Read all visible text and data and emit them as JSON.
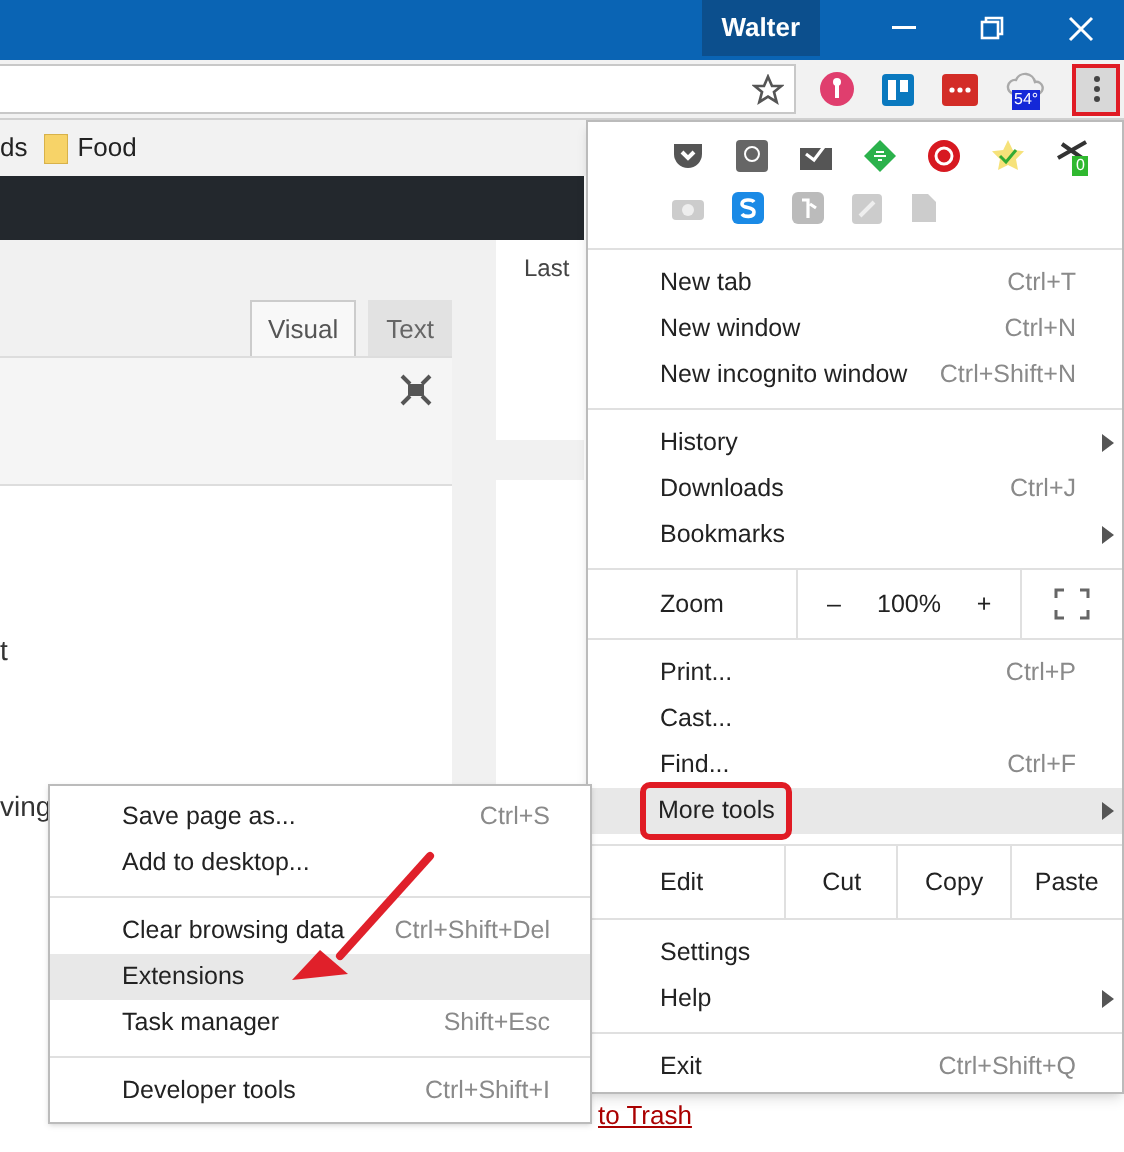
{
  "window": {
    "user": "Walter"
  },
  "toolbar": {
    "weather_badge": "54°",
    "menu_button_annotated": true
  },
  "bookmarks": [
    {
      "label": "ds"
    },
    {
      "label": "Food"
    }
  ],
  "editor": {
    "tabs": [
      {
        "label": "Visual",
        "selected": true
      },
      {
        "label": "Text",
        "selected": false
      }
    ],
    "fragments": [
      "t",
      "ving"
    ],
    "side_label": "Last",
    "link": "to Trash"
  },
  "menu": {
    "extension_badge": "0",
    "sections": [
      [
        {
          "kind": "item",
          "label": "New tab",
          "shortcut": "Ctrl+T",
          "submenu": false,
          "highlighted": false,
          "annotated": false
        },
        {
          "kind": "item",
          "label": "New window",
          "shortcut": "Ctrl+N",
          "submenu": false,
          "highlighted": false,
          "annotated": false
        },
        {
          "kind": "item",
          "label": "New incognito window",
          "shortcut": "Ctrl+Shift+N",
          "submenu": false,
          "highlighted": false,
          "annotated": false
        }
      ],
      [
        {
          "kind": "item",
          "label": "History",
          "submenu": true,
          "highlighted": false,
          "annotated": false
        },
        {
          "kind": "item",
          "label": "Downloads",
          "shortcut": "Ctrl+J",
          "submenu": false,
          "highlighted": false,
          "annotated": false
        },
        {
          "kind": "item",
          "label": "Bookmarks",
          "submenu": true,
          "highlighted": false,
          "annotated": false
        }
      ],
      [
        {
          "kind": "zoom",
          "label": "Zoom",
          "minus": "–",
          "value": "100%",
          "plus": "+"
        }
      ],
      [
        {
          "kind": "item",
          "label": "Print...",
          "shortcut": "Ctrl+P",
          "submenu": false,
          "highlighted": false,
          "annotated": false
        },
        {
          "kind": "item",
          "label": "Cast...",
          "submenu": false,
          "highlighted": false,
          "annotated": false
        },
        {
          "kind": "item",
          "label": "Find...",
          "shortcut": "Ctrl+F",
          "submenu": false,
          "highlighted": false,
          "annotated": false
        },
        {
          "kind": "item",
          "label": "More tools",
          "submenu": true,
          "highlighted": true,
          "annotated": true
        }
      ],
      [
        {
          "kind": "edit",
          "label": "Edit",
          "buttons": [
            "Cut",
            "Copy",
            "Paste"
          ]
        }
      ],
      [
        {
          "kind": "item",
          "label": "Settings",
          "submenu": false,
          "highlighted": false,
          "annotated": false
        },
        {
          "kind": "item",
          "label": "Help",
          "submenu": true,
          "highlighted": false,
          "annotated": false
        }
      ],
      [
        {
          "kind": "item",
          "label": "Exit",
          "shortcut": "Ctrl+Shift+Q",
          "submenu": false,
          "highlighted": false,
          "annotated": false
        }
      ]
    ]
  },
  "submenu": {
    "sections": [
      [
        {
          "label": "Save page as...",
          "shortcut": "Ctrl+S",
          "highlighted": false
        },
        {
          "label": "Add to desktop...",
          "highlighted": false
        }
      ],
      [
        {
          "label": "Clear browsing data",
          "shortcut": "Ctrl+Shift+Del",
          "highlighted": false
        },
        {
          "label": "Extensions",
          "highlighted": true
        },
        {
          "label": "Task manager",
          "shortcut": "Shift+Esc",
          "highlighted": false
        }
      ],
      [
        {
          "label": "Developer tools",
          "shortcut": "Ctrl+Shift+I",
          "highlighted": false
        }
      ]
    ]
  }
}
